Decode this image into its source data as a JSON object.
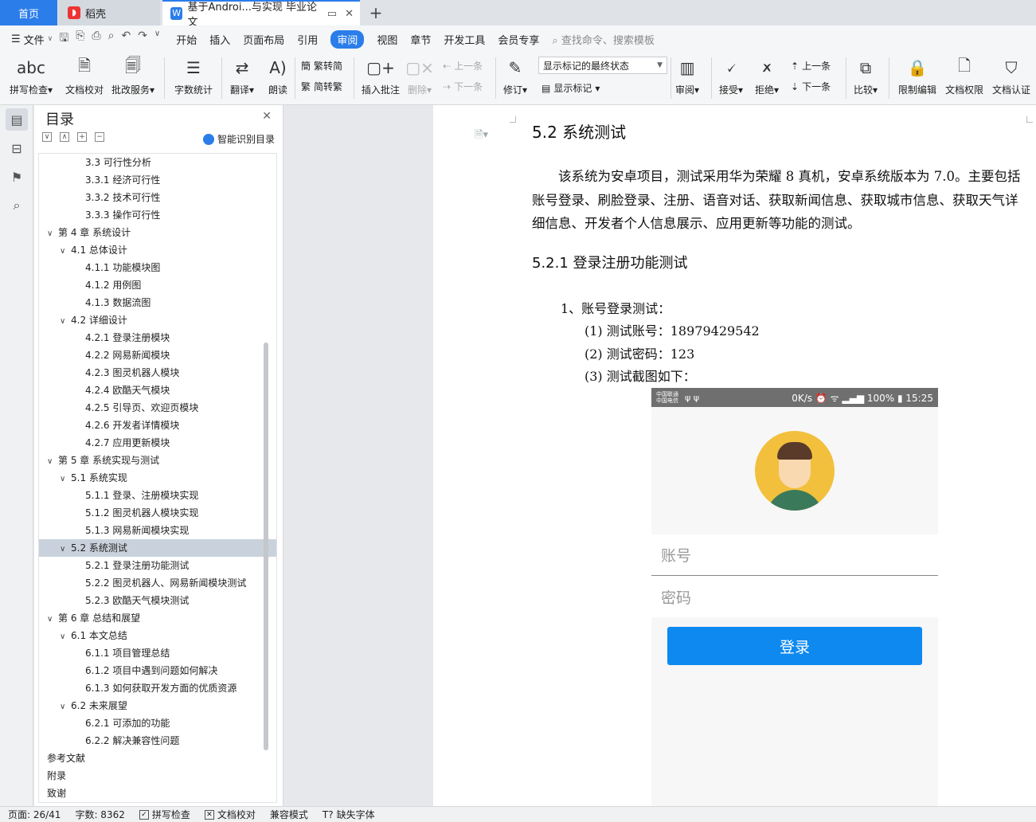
{
  "tabs": {
    "home": "首页",
    "daoke": "稻壳",
    "doc": "基于Androi...与实现 毕业论文"
  },
  "menu": {
    "file": "文件",
    "items": [
      "开始",
      "插入",
      "页面布局",
      "引用",
      "审阅",
      "视图",
      "章节",
      "开发工具",
      "会员专享"
    ],
    "search_placeholder": "查找命令、搜索模板"
  },
  "ribbon": {
    "spell": "拼写检查",
    "proof": "文档校对",
    "correct": "批改服务",
    "wordcount": "字数统计",
    "translate": "翻译",
    "read": "朗读",
    "trad": "繁转简",
    "simp": "简转繁",
    "insert_comment": "插入批注",
    "delete": "删除",
    "prev_comment": "上一条",
    "next_comment": "下一条",
    "revise": "修订",
    "markup_state": "显示标记的最终状态",
    "show_markup": "显示标记",
    "review": "审阅",
    "accept": "接受",
    "reject": "拒绝",
    "prev_change": "上一条",
    "next_change": "下一条",
    "compare": "比较",
    "restrict": "限制编辑",
    "permission": "文档权限",
    "certify": "文档认证"
  },
  "toc": {
    "title": "目录",
    "smart": "智能识别目录",
    "items": [
      {
        "text": "3.3 可行性分析",
        "level": 3,
        "caret": ""
      },
      {
        "text": "3.3.1  经济可行性",
        "level": 3,
        "caret": ""
      },
      {
        "text": "3.3.2  技术可行性",
        "level": 3,
        "caret": ""
      },
      {
        "text": "3.3.3  操作可行性",
        "level": 3,
        "caret": ""
      },
      {
        "text": "第 4 章  系统设计",
        "level": 1,
        "caret": "∨"
      },
      {
        "text": "4.1  总体设计",
        "level": 2,
        "caret": "∨"
      },
      {
        "text": "4.1.1  功能模块图",
        "level": 3,
        "caret": ""
      },
      {
        "text": "4.1.2  用例图",
        "level": 3,
        "caret": ""
      },
      {
        "text": "4.1.3  数据流图",
        "level": 3,
        "caret": ""
      },
      {
        "text": "4.2  详细设计",
        "level": 2,
        "caret": "∨"
      },
      {
        "text": "4.2.1  登录注册模块",
        "level": 3,
        "caret": ""
      },
      {
        "text": "4.2.2  网易新闻模块",
        "level": 3,
        "caret": ""
      },
      {
        "text": "4.2.3  图灵机器人模块",
        "level": 3,
        "caret": ""
      },
      {
        "text": "4.2.4  欧酷天气模块",
        "level": 3,
        "caret": ""
      },
      {
        "text": "4.2.5  引导页、欢迎页模块",
        "level": 3,
        "caret": ""
      },
      {
        "text": "4.2.6  开发者详情模块",
        "level": 3,
        "caret": ""
      },
      {
        "text": "4.2.7  应用更新模块",
        "level": 3,
        "caret": ""
      },
      {
        "text": "第 5 章  系统实现与测试",
        "level": 1,
        "caret": "∨"
      },
      {
        "text": "5.1  系统实现",
        "level": 2,
        "caret": "∨"
      },
      {
        "text": "5.1.1  登录、注册模块实现",
        "level": 3,
        "caret": ""
      },
      {
        "text": "5.1.2  图灵机器人模块实现",
        "level": 3,
        "caret": ""
      },
      {
        "text": "5.1.3  网易新闻模块实现",
        "level": 3,
        "caret": ""
      },
      {
        "text": "5.2  系统测试",
        "level": 2,
        "caret": "∨",
        "selected": true
      },
      {
        "text": "5.2.1  登录注册功能测试",
        "level": 3,
        "caret": ""
      },
      {
        "text": "5.2.2  图灵机器人、网易新闻模块测试",
        "level": 3,
        "caret": ""
      },
      {
        "text": "5.2.3  欧酷天气模块测试",
        "level": 3,
        "caret": ""
      },
      {
        "text": "第 6 章  总结和展望",
        "level": 1,
        "caret": "∨"
      },
      {
        "text": "6.1  本文总结",
        "level": 2,
        "caret": "∨"
      },
      {
        "text": "6.1.1  项目管理总结",
        "level": 3,
        "caret": ""
      },
      {
        "text": "6.1.2  项目中遇到问题如何解决",
        "level": 3,
        "caret": ""
      },
      {
        "text": "6.1.3  如何获取开发方面的优质资源",
        "level": 3,
        "caret": ""
      },
      {
        "text": "6.2  未来展望",
        "level": 2,
        "caret": "∨"
      },
      {
        "text": "6.2.1  可添加的功能",
        "level": 3,
        "caret": ""
      },
      {
        "text": "6.2.2  解决兼容性问题",
        "level": 3,
        "caret": ""
      },
      {
        "text": "参考文献",
        "level": 1,
        "caret": ""
      },
      {
        "text": "附录",
        "level": 1,
        "caret": ""
      },
      {
        "text": "致谢",
        "level": 1,
        "caret": ""
      }
    ]
  },
  "doc": {
    "h2": "5.2  系统测试",
    "para": "该系统为安卓项目，测试采用华为荣耀 8 真机，安卓系统版本为 7.0。主要包括账号登录、刷脸登录、注册、语音对话、获取新闻信息、获取城市信息、获取天气详细信息、开发者个人信息展示、应用更新等功能的测试。",
    "h3": "5.2.1  登录注册功能测试",
    "l1": "1、账号登录测试：",
    "l2": "(1) 测试账号：18979429542",
    "l3": "(2) 测试密码：123",
    "l4": "(3) 测试截图如下："
  },
  "phone": {
    "carrier1": "中国联通",
    "carrier2": "中国电信",
    "status_right": "0K/s ⏰ ᯤ ▂▄▆ 100% ▮ 15:25",
    "account": "账号",
    "password": "密码",
    "login": "登录"
  },
  "statusbar": {
    "page": "页面: 26/41",
    "words": "字数: 8362",
    "spell": "拼写检查",
    "proof": "文档校对",
    "compat": "兼容模式",
    "missing_font": "缺失字体"
  }
}
